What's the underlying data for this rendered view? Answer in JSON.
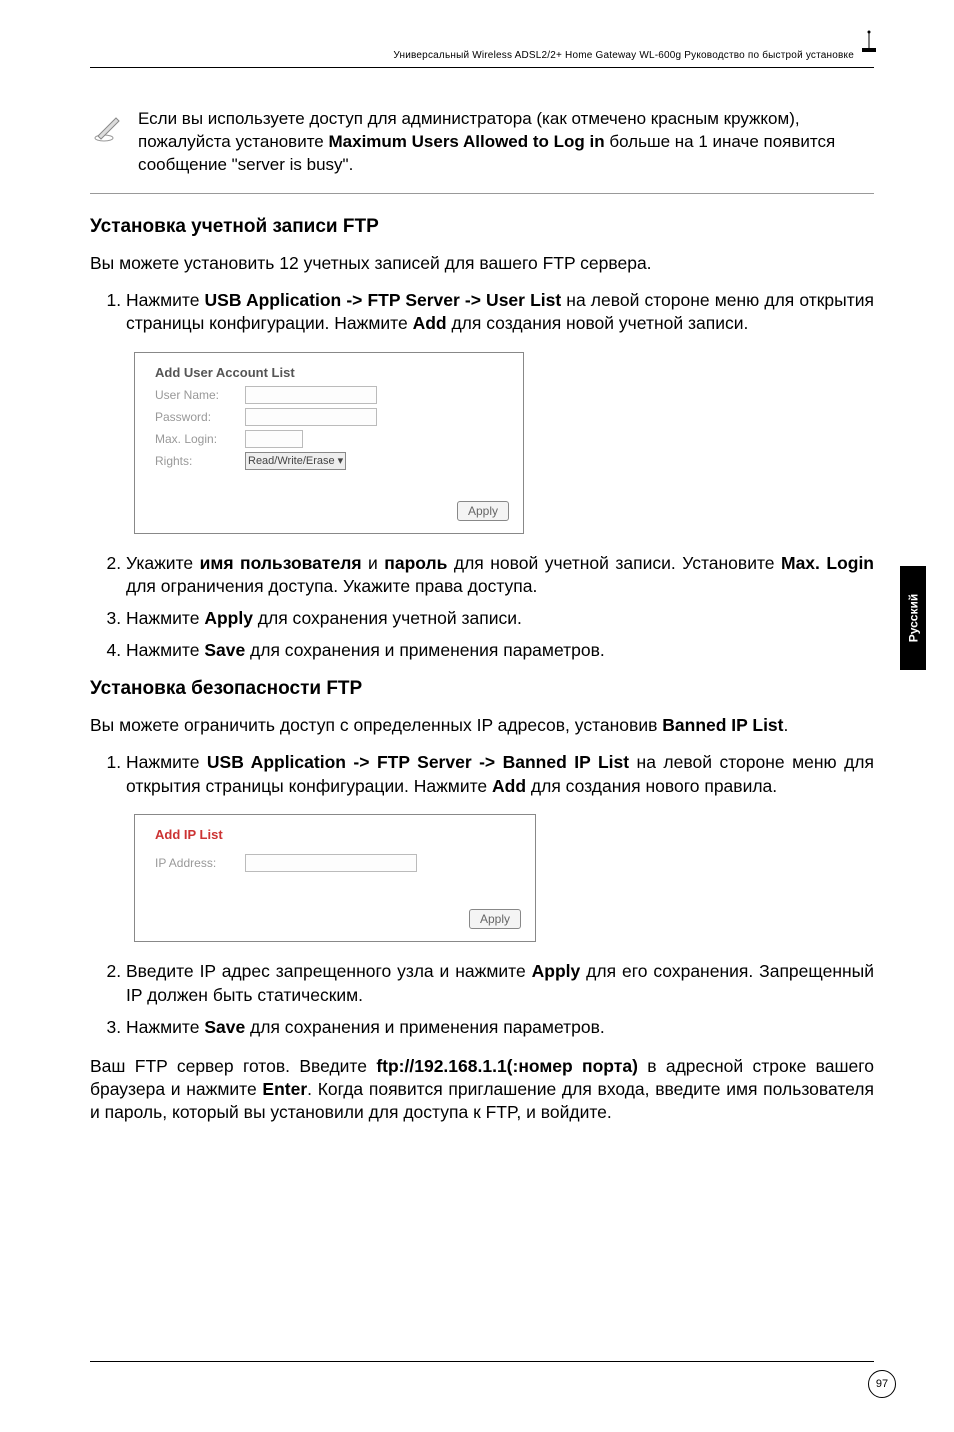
{
  "header": {
    "text": "Универсальный Wireless ADSL2/2+ Home Gateway  WL-600g Руководство по быстрой установке"
  },
  "note": {
    "text_before": "Если вы используете доступ для администратора (как отмечено красным кружком), пожалуйста установите ",
    "bold": "Maximum Users Allowed to Log in",
    "text_after": " больше на 1 иначе появится сообщение \"server is busy\"."
  },
  "section1": {
    "title": "Установка учетной записи FTP",
    "intro": "Вы можете установить 12 учетных записей для вашего FTP сервера.",
    "step1_a": "Нажмите ",
    "step1_b": "USB Application -> FTP Server -> User List",
    "step1_c": " на левой стороне меню для открытия страницы конфигурации. Нажмите ",
    "step1_d": "Add",
    "step1_e": " для создания новой учетной записи.",
    "screenshot": {
      "title": "Add User Account List",
      "user_name": "User Name:",
      "password": "Password:",
      "max_login": "Max. Login:",
      "rights": "Rights:",
      "rights_value": "Read/Write/Erase ▾",
      "apply": "Apply"
    },
    "step2_a": "Укажите ",
    "step2_b": "имя пользователя",
    "step2_c": " и ",
    "step2_d": "пароль",
    "step2_e": " для новой учетной записи. Установите ",
    "step2_f": "Max. Login",
    "step2_g": " для ограничения доступа. Укажите права доступа.",
    "step3_a": "Нажмите ",
    "step3_b": "Apply",
    "step3_c": " для сохранения учетной записи.",
    "step4_a": "Нажмите ",
    "step4_b": "Save",
    "step4_c": " для сохранения и применения параметров."
  },
  "section2": {
    "title": "Установка безопасности FTP",
    "intro_a": "Вы можете ограничить доступ с определенных  IP адресов, установив ",
    "intro_b": "Banned IP List",
    "intro_c": ".",
    "step1_a": "Нажмите ",
    "step1_b": "USB Application -> FTP Server -> Banned IP List",
    "step1_c": " на левой стороне меню для открытия страницы конфигурации. Нажмите ",
    "step1_d": "Add",
    "step1_e": " для создания нового правила.",
    "screenshot": {
      "title": "Add IP List",
      "ip_address": "IP Address:",
      "apply": "Apply"
    },
    "step2_a": "Введите IP адрес запрещенного узла и нажмите ",
    "step2_b": "Apply",
    "step2_c": " для его сохранения. Запрещенный IP должен быть статическим.",
    "step3_a": "Нажмите ",
    "step3_b": "Save",
    "step3_c": " для сохранения и применения параметров.",
    "closing_a": "Ваш FTP сервер готов. Введите ",
    "closing_b": "ftp://192.168.1.1(:номер порта)",
    "closing_c": " в адресной строке вашего браузера и нажмите ",
    "closing_d": "Enter",
    "closing_e": ". Когда появится приглашение для входа, введите имя пользователя и пароль, который вы установили для доступа к FTP, и войдите."
  },
  "side_tab": "Русский",
  "page_number": "97"
}
